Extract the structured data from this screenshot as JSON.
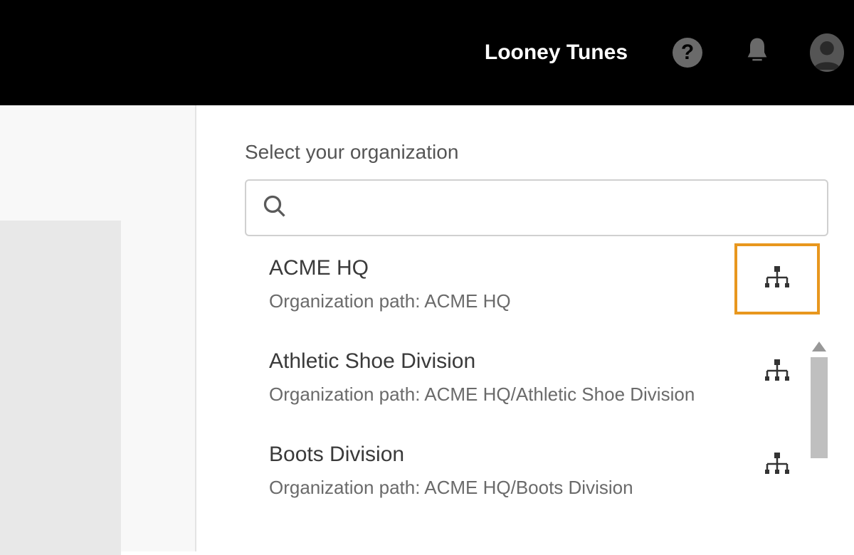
{
  "header": {
    "org_name": "Looney Tunes"
  },
  "main": {
    "title": "Select your organization",
    "search_placeholder": "",
    "path_prefix": "Organization path: ",
    "organizations": [
      {
        "name": "ACME HQ",
        "path": "ACME HQ",
        "highlighted": true
      },
      {
        "name": "Athletic Shoe Division",
        "path": "ACME HQ/Athletic Shoe Division",
        "highlighted": false
      },
      {
        "name": "Boots Division",
        "path": "ACME HQ/Boots Division",
        "highlighted": false
      }
    ]
  }
}
